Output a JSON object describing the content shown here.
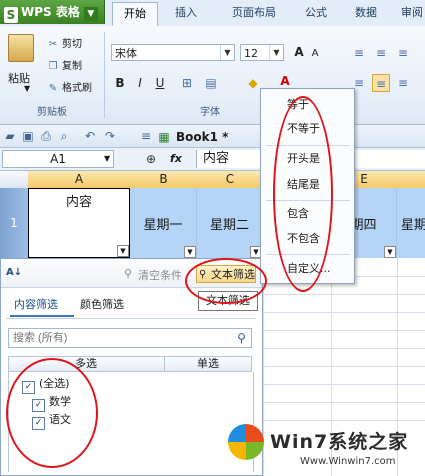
{
  "app": {
    "name": "WPS 表格",
    "logo_letter": "S"
  },
  "ribbon_tabs": [
    "开始",
    "插入",
    "页面布局",
    "公式",
    "数据",
    "审阅"
  ],
  "clipboard": {
    "paste": "粘贴",
    "cut": "剪切",
    "copy": "复制",
    "format_painter": "格式刷",
    "group_label": "剪贴板"
  },
  "font": {
    "family": "宋体",
    "size": "12",
    "grow": "A",
    "shrink": "A",
    "bold": "B",
    "italic": "I",
    "underline": "U",
    "group_label": "字体"
  },
  "toolbar": {
    "book_name": "Book1 *"
  },
  "formula_bar": {
    "cell_ref": "A1",
    "fx": "fx",
    "value": "内容"
  },
  "columns": [
    "A",
    "B",
    "C",
    "D",
    "E"
  ],
  "row_number": "1",
  "cells": [
    "内容",
    "星期一",
    "星期二",
    "",
    "期四",
    "星期"
  ],
  "filter_panel": {
    "sort_label": "A↓",
    "clear": "清空条件",
    "text_filter": "文本筛选",
    "text_filter_tooltip": "文本筛选",
    "tabs": [
      "内容筛选",
      "颜色筛选"
    ],
    "search_placeholder": "搜索 (所有)",
    "col_multi": "多选",
    "col_single": "单选",
    "items": [
      {
        "label": "(全选)",
        "checked": true
      },
      {
        "label": "数学",
        "checked": true
      },
      {
        "label": "语文",
        "checked": true
      }
    ]
  },
  "text_filter_menu": [
    "等于",
    "不等于",
    "开头是",
    "结尾是",
    "包含",
    "不包含",
    "自定义..."
  ],
  "watermark": {
    "title": "Win7系统之家",
    "url": "Www.Winwin7.com"
  },
  "colors": {
    "accent_green": "#3b8123",
    "selected_col": "#b4d4f6",
    "annotation_red": "#e0141b"
  }
}
